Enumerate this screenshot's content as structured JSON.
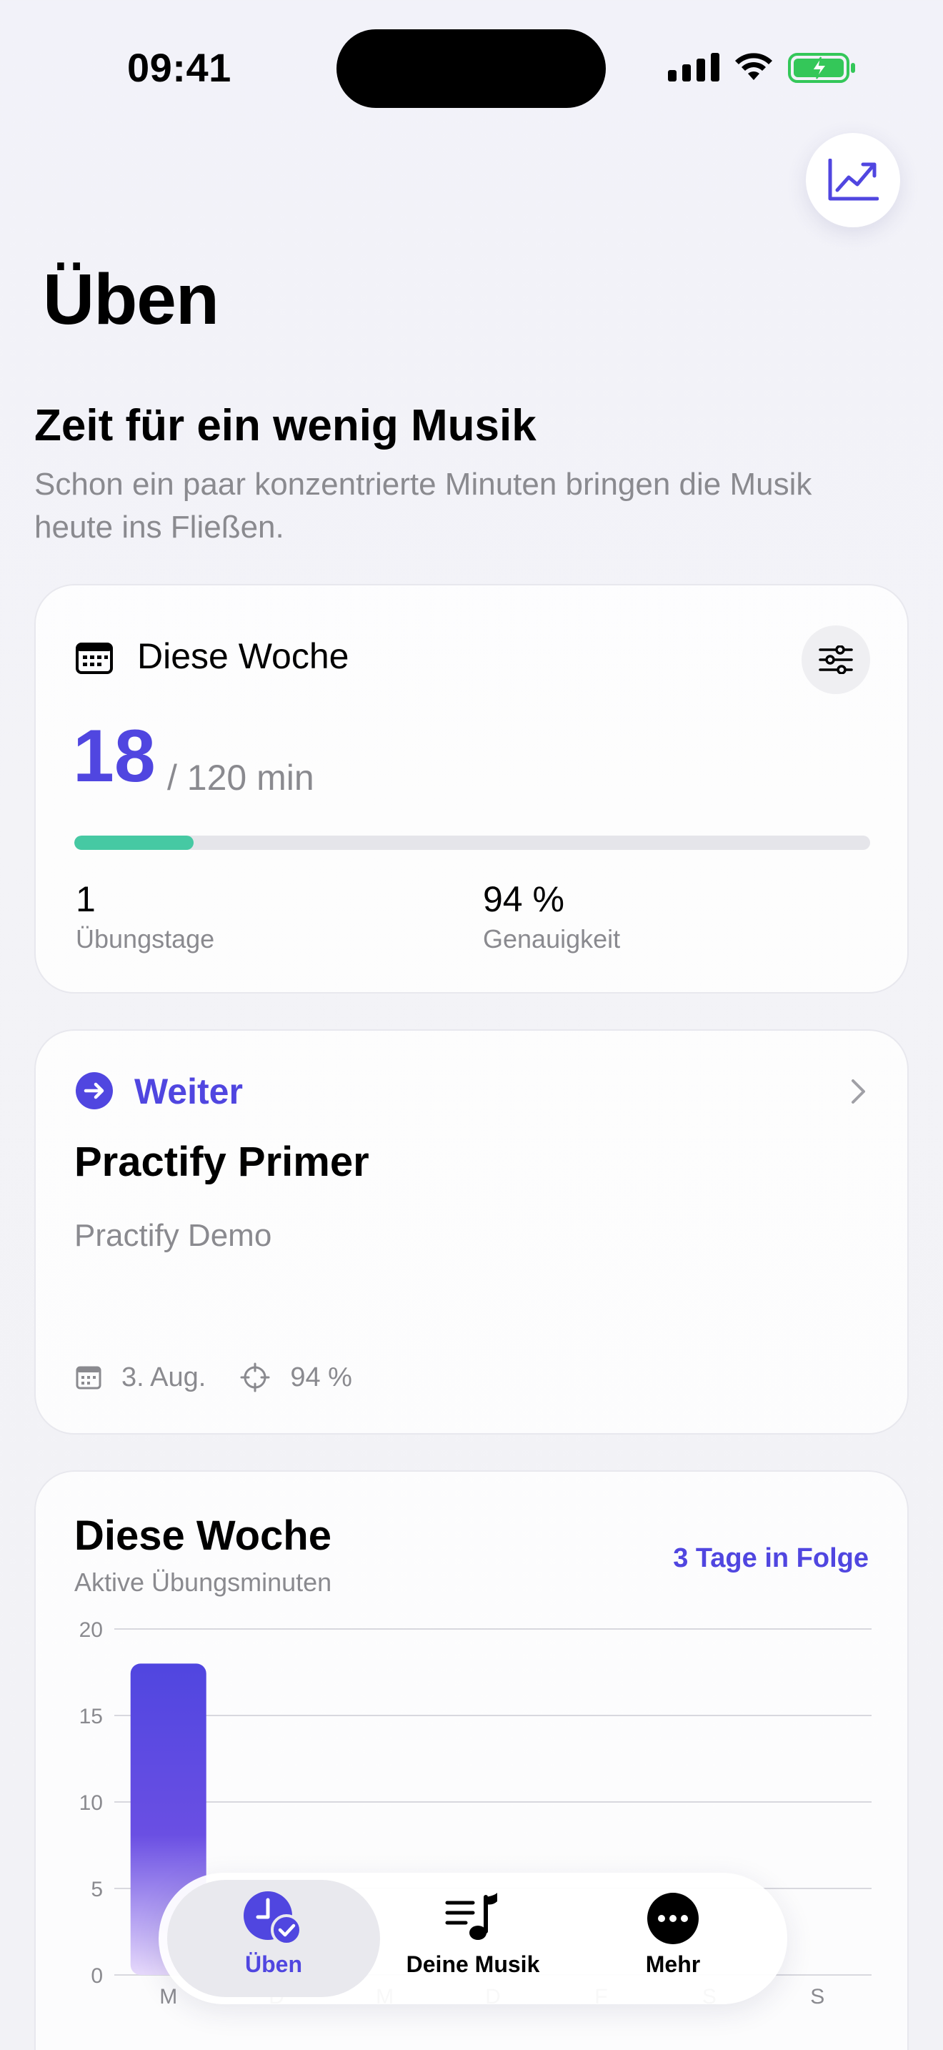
{
  "status_bar": {
    "time": "09:41"
  },
  "header": {
    "title": "Üben",
    "trend_icon": "chart-trend-icon"
  },
  "hero": {
    "title": "Zeit für ein wenig Musik",
    "subtitle_line1": "Schon ein paar konzentrierte Minuten bringen die Musik",
    "subtitle_line2": "heute ins Fließen."
  },
  "week_card": {
    "title": "Diese Woche",
    "minutes": "18",
    "goal": "/ 120 min",
    "progress_fraction": 0.15,
    "stats": [
      {
        "value": "1",
        "label": "Übungstage"
      },
      {
        "value": "94 %",
        "label": "Genauigkeit"
      }
    ]
  },
  "continue_card": {
    "label": "Weiter",
    "title": "Practify Primer",
    "subtitle": "Practify Demo",
    "date": "3. Aug.",
    "accuracy": "94 %"
  },
  "chart_card": {
    "title": "Diese Woche",
    "subtitle": "Aktive Übungsminuten",
    "streak": "3 Tage in Folge"
  },
  "chart_data": {
    "type": "bar",
    "categories": [
      "M",
      "D",
      "M",
      "D",
      "F",
      "S",
      "S"
    ],
    "values": [
      18,
      0,
      0,
      0,
      0,
      0,
      0
    ],
    "y_ticks": [
      "20",
      "15",
      "10",
      "5",
      "0"
    ],
    "ylim": [
      0,
      20
    ],
    "grid": true,
    "bar_color": "#5046e0"
  },
  "tabbar": {
    "tabs": [
      {
        "label": "Üben",
        "active": true
      },
      {
        "label": "Deine Musik",
        "active": false
      },
      {
        "label": "Mehr",
        "active": false
      }
    ]
  },
  "colors": {
    "accent": "#5046e0",
    "progress": "#46c9a3",
    "muted": "#8a8a8f"
  }
}
